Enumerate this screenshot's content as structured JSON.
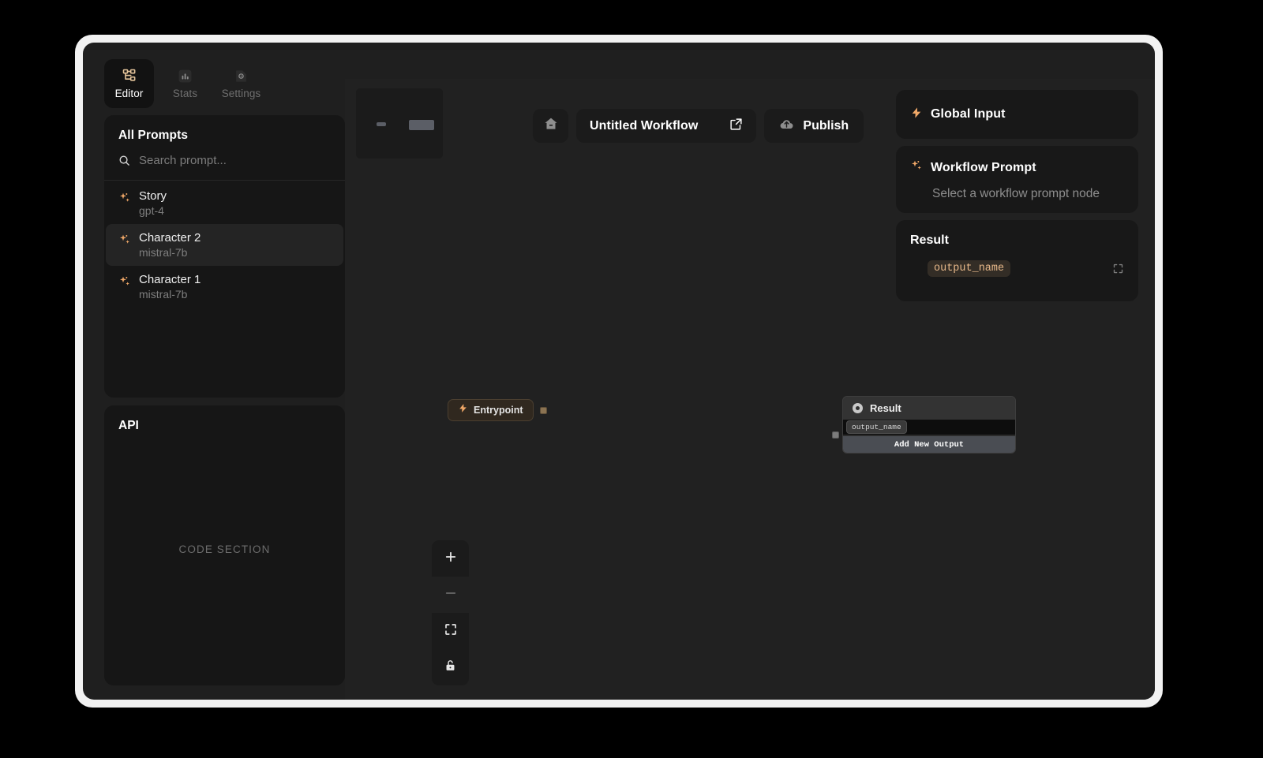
{
  "tabs": [
    {
      "label": "Editor",
      "icon": "workflow-tree-icon",
      "active": true
    },
    {
      "label": "Stats",
      "icon": "bar-chart-icon",
      "active": false
    },
    {
      "label": "Settings",
      "icon": "gear-document-icon",
      "active": false
    }
  ],
  "sidebar": {
    "prompts_title": "All Prompts",
    "search": {
      "icon": "search-icon",
      "placeholder": "Search prompt...",
      "value": ""
    },
    "prompts": [
      {
        "name": "Story",
        "model": "gpt-4",
        "icon": "sparkles-icon",
        "selected": false
      },
      {
        "name": "Character 2",
        "model": "mistral-7b",
        "icon": "sparkles-icon",
        "selected": true
      },
      {
        "name": "Character 1",
        "model": "mistral-7b",
        "icon": "sparkles-icon",
        "selected": false
      }
    ],
    "api": {
      "title": "API",
      "placeholder": "CODE SECTION"
    }
  },
  "toolbar": {
    "home_icon": "home-icon",
    "workflow_title": "Untitled Workflow",
    "open_external_icon": "external-link-icon",
    "publish_label": "Publish",
    "publish_icon": "cloud-upload-icon"
  },
  "canvas": {
    "minimap": {
      "name": "minimap"
    },
    "entrypoint_node": {
      "label": "Entrypoint",
      "icon": "lightning-icon"
    },
    "result_node": {
      "title": "Result",
      "icon": "circle-dot-icon",
      "output_name": "output_name",
      "add_output_label": "Add New Output"
    },
    "zoom_controls": [
      {
        "name": "zoom-in-button",
        "icon": "plus-icon"
      },
      {
        "name": "zoom-out-button",
        "icon": "minus-icon"
      },
      {
        "name": "fit-view-button",
        "icon": "fit-view-icon"
      },
      {
        "name": "lock-canvas-button",
        "icon": "unlock-icon"
      }
    ]
  },
  "right_panel": {
    "global_input": {
      "title": "Global Input",
      "icon": "lightning-icon"
    },
    "workflow_prompt": {
      "title": "Workflow Prompt",
      "icon": "sparkles-icon",
      "empty_text": "Select a workflow prompt node"
    },
    "result": {
      "title": "Result",
      "chip": "output_name",
      "expand_icon": "expand-icon"
    }
  },
  "colors": {
    "accent": "#f0a868",
    "accent_soft": "#e8b98a",
    "editor_icon": "#e3c39a",
    "panel_bg": "#181818",
    "canvas_bg": "#212121",
    "window_bg": "#1f1f1f",
    "frame": "#f2f2f2"
  }
}
